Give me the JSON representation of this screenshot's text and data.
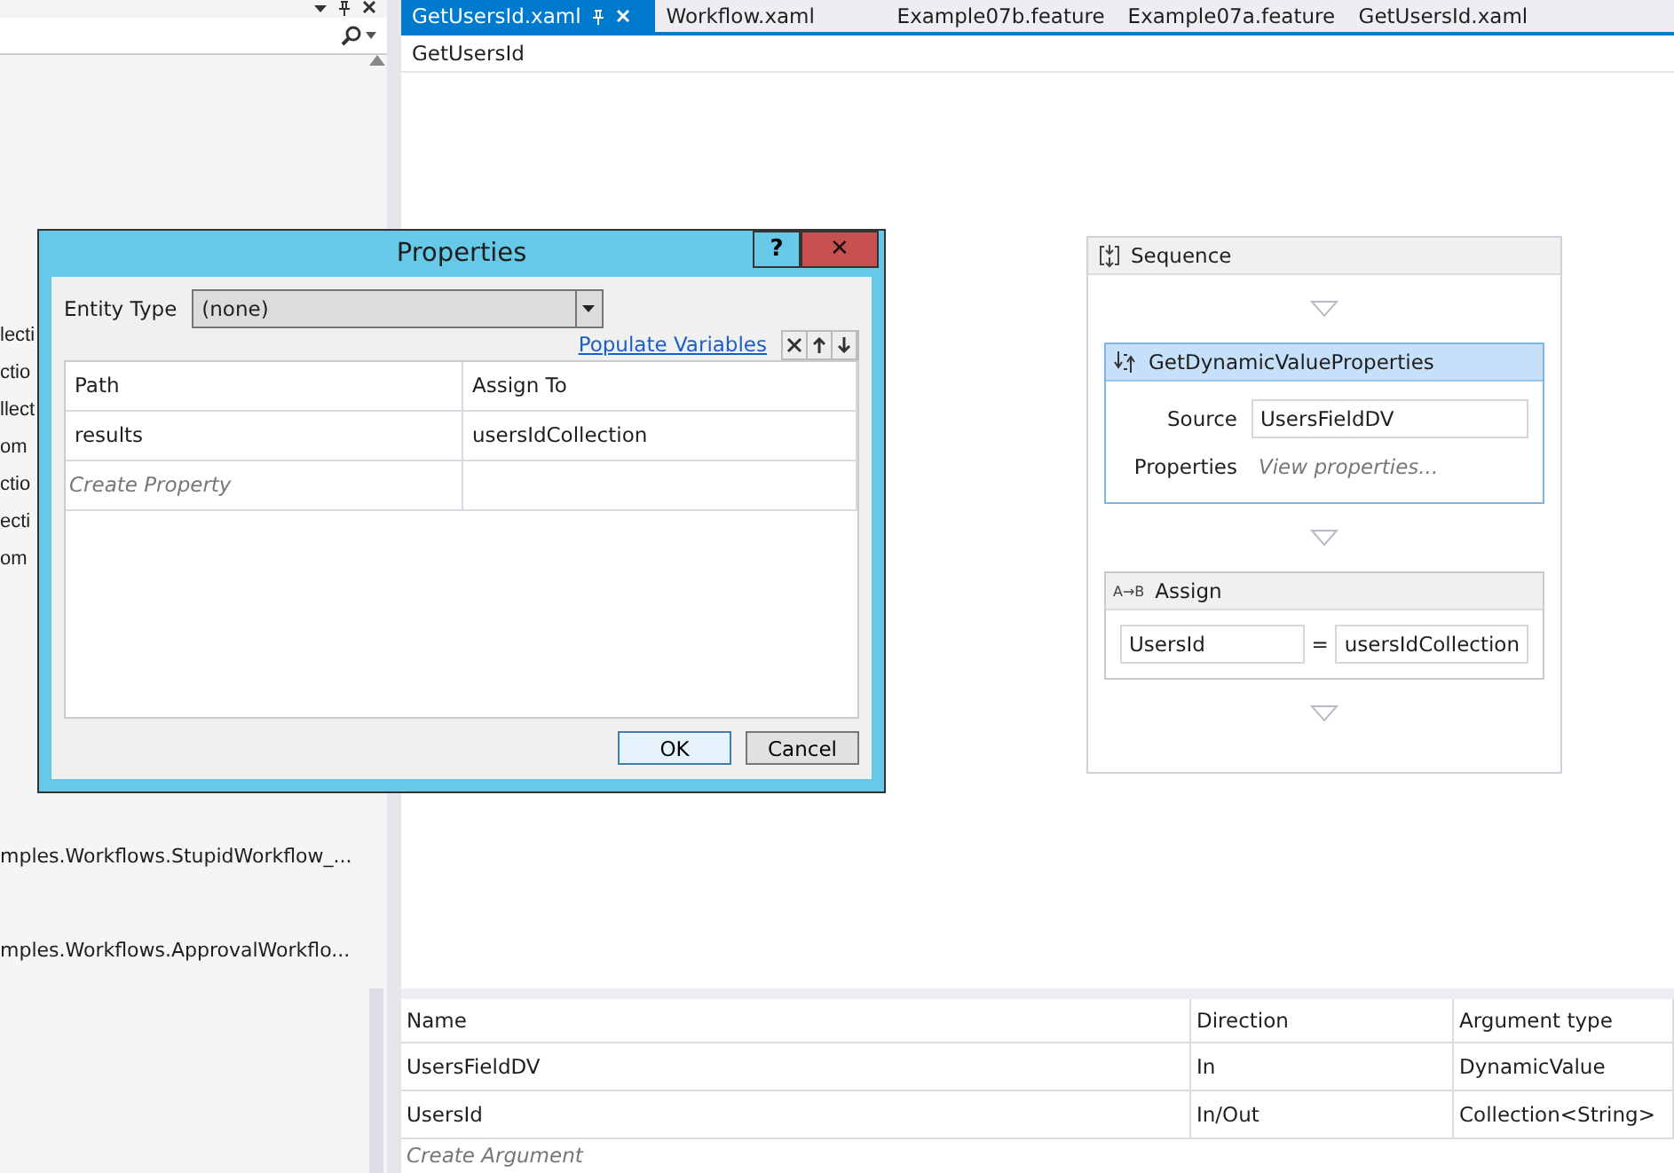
{
  "tabs": [
    {
      "label": "GetUsersId.xaml",
      "selected": true
    },
    {
      "label": "Workflow.xaml",
      "selected": false
    },
    {
      "label": "Example07b.feature",
      "selected": false
    },
    {
      "label": "Example07a.feature",
      "selected": false
    },
    {
      "label": "GetUsersId.xaml",
      "selected": false
    }
  ],
  "left_panel": {
    "items": [
      "lecti",
      "ctio",
      "llect",
      "om",
      "ctio",
      "ecti",
      "om"
    ],
    "lower_items": [
      "mples.Workflows.StupidWorkflow_...",
      "mples.Workflows.ApprovalWorkflo..."
    ]
  },
  "breadcrumb": "GetUsersId",
  "sequence": {
    "title": "Sequence",
    "activities": [
      {
        "kind": "properties",
        "title": "GetDynamicValueProperties",
        "selected": true,
        "source_label": "Source",
        "source_value": "UsersFieldDV",
        "properties_label": "Properties",
        "properties_hint": "View properties..."
      },
      {
        "kind": "assign",
        "title": "Assign",
        "icon_text": "A→B",
        "to": "UsersId",
        "equals": "=",
        "value": "usersIdCollection",
        "selected": false
      }
    ]
  },
  "arguments": {
    "columns": [
      "Name",
      "Direction",
      "Argument type"
    ],
    "rows": [
      [
        "UsersFieldDV",
        "In",
        "DynamicValue"
      ],
      [
        "UsersId",
        "In/Out",
        "Collection<String>"
      ]
    ],
    "create": "Create Argument"
  },
  "dialog": {
    "title": "Properties",
    "help": "?",
    "close": "✕",
    "entity_label": "Entity Type",
    "entity_value": "(none)",
    "populate_link": "Populate Variables",
    "columns": [
      "Path",
      "Assign To"
    ],
    "rows": [
      [
        "results",
        "usersIdCollection"
      ]
    ],
    "create": "Create Property",
    "buttons": [
      {
        "label": "OK",
        "default": true
      },
      {
        "label": "Cancel",
        "default": false
      }
    ]
  }
}
